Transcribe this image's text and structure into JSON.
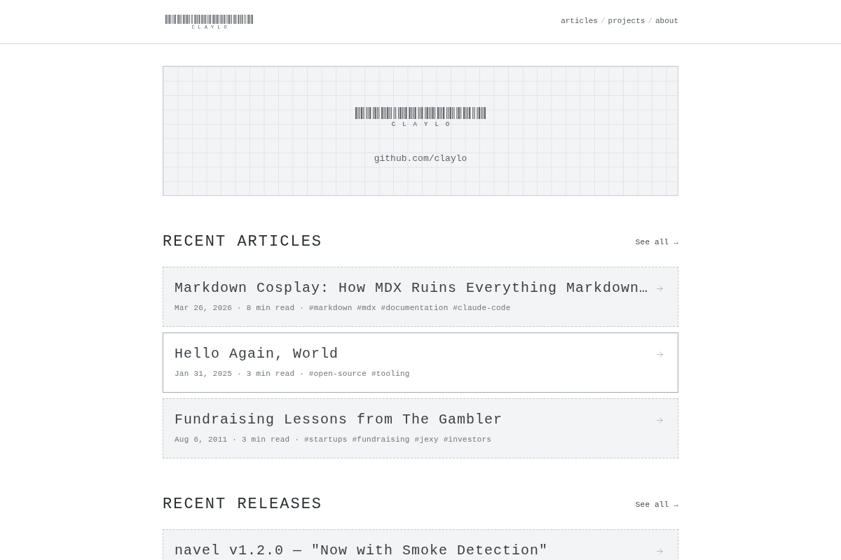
{
  "header": {
    "logo": {
      "wordmark": "CLAYLO"
    },
    "nav": [
      {
        "kind": "link",
        "label": "articles"
      },
      {
        "kind": "separator",
        "label": "/"
      },
      {
        "kind": "link",
        "label": "projects"
      },
      {
        "kind": "separator",
        "label": "/"
      },
      {
        "kind": "link",
        "label": "about"
      }
    ]
  },
  "hero": {
    "wordmark": "CLAYLO",
    "link": "github.com/claylo"
  },
  "sections": [
    {
      "title": "RECENT ARTICLES",
      "see_all": "See all →",
      "items": [
        {
          "title": "Markdown Cosplay: How MDX Ruins Everything Markdown…",
          "hovered": false,
          "meta": "Mar 26, 2026 · 8 min read · #markdown #mdx #documentation #claude-code"
        },
        {
          "title": "Hello Again, World",
          "hovered": true,
          "meta": "Jan 31, 2025 · 3 min read · #open-source #tooling"
        },
        {
          "title": "Fundraising Lessons from The Gambler",
          "hovered": false,
          "meta": "Aug 6, 2011 · 3 min read · #startups #fundraising #jexy #investors"
        }
      ]
    },
    {
      "title": "RECENT RELEASES",
      "see_all": "See all →",
      "items": [
        {
          "title": "navel v1.2.0 — \"Now with Smoke Detection\"",
          "hovered": false
        }
      ]
    }
  ]
}
